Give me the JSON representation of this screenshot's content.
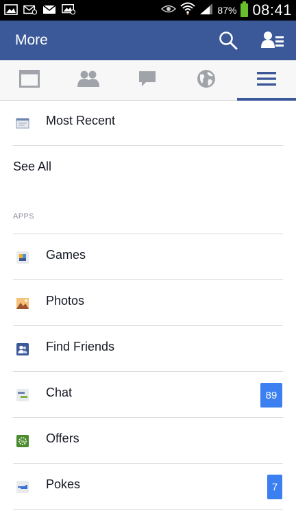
{
  "status_bar": {
    "left_icons": [
      "gallery-notification-icon",
      "email-notification-icon",
      "gmail-notification-icon",
      "message-notification-icon"
    ],
    "right_icons": [
      "eye-icon",
      "wifi-icon",
      "signal-icon"
    ],
    "battery_percent": "87%",
    "time": "08:41",
    "battery_color": "#6abf2e"
  },
  "header": {
    "title": "More",
    "bg_color": "#3b5998",
    "search_icon": "search-icon",
    "profile_icon": "friends-list-icon"
  },
  "tabs": [
    {
      "name": "news-feed",
      "icon": "news-feed-icon",
      "active": false
    },
    {
      "name": "friend-requests",
      "icon": "friends-icon",
      "active": false
    },
    {
      "name": "messages",
      "icon": "chat-bubble-icon",
      "active": false
    },
    {
      "name": "notifications",
      "icon": "globe-icon",
      "active": false
    },
    {
      "name": "more",
      "icon": "menu-icon",
      "active": true
    }
  ],
  "feeds": {
    "most_recent": "Most Recent",
    "see_all": "See All"
  },
  "apps": {
    "heading": "APPS",
    "items": [
      {
        "label": "Games",
        "icon": "games-icon",
        "badge": ""
      },
      {
        "label": "Photos",
        "icon": "photos-icon",
        "badge": ""
      },
      {
        "label": "Find Friends",
        "icon": "find-friends-icon",
        "badge": ""
      },
      {
        "label": "Chat",
        "icon": "chat-icon",
        "badge": "89"
      },
      {
        "label": "Offers",
        "icon": "offers-icon",
        "badge": ""
      },
      {
        "label": "Pokes",
        "icon": "pokes-icon",
        "badge": "7"
      }
    ]
  },
  "colors": {
    "brand": "#3b5998",
    "badge": "#3b7ff0",
    "separator": "#dadada",
    "tab_icon": "#a0a3a9"
  }
}
